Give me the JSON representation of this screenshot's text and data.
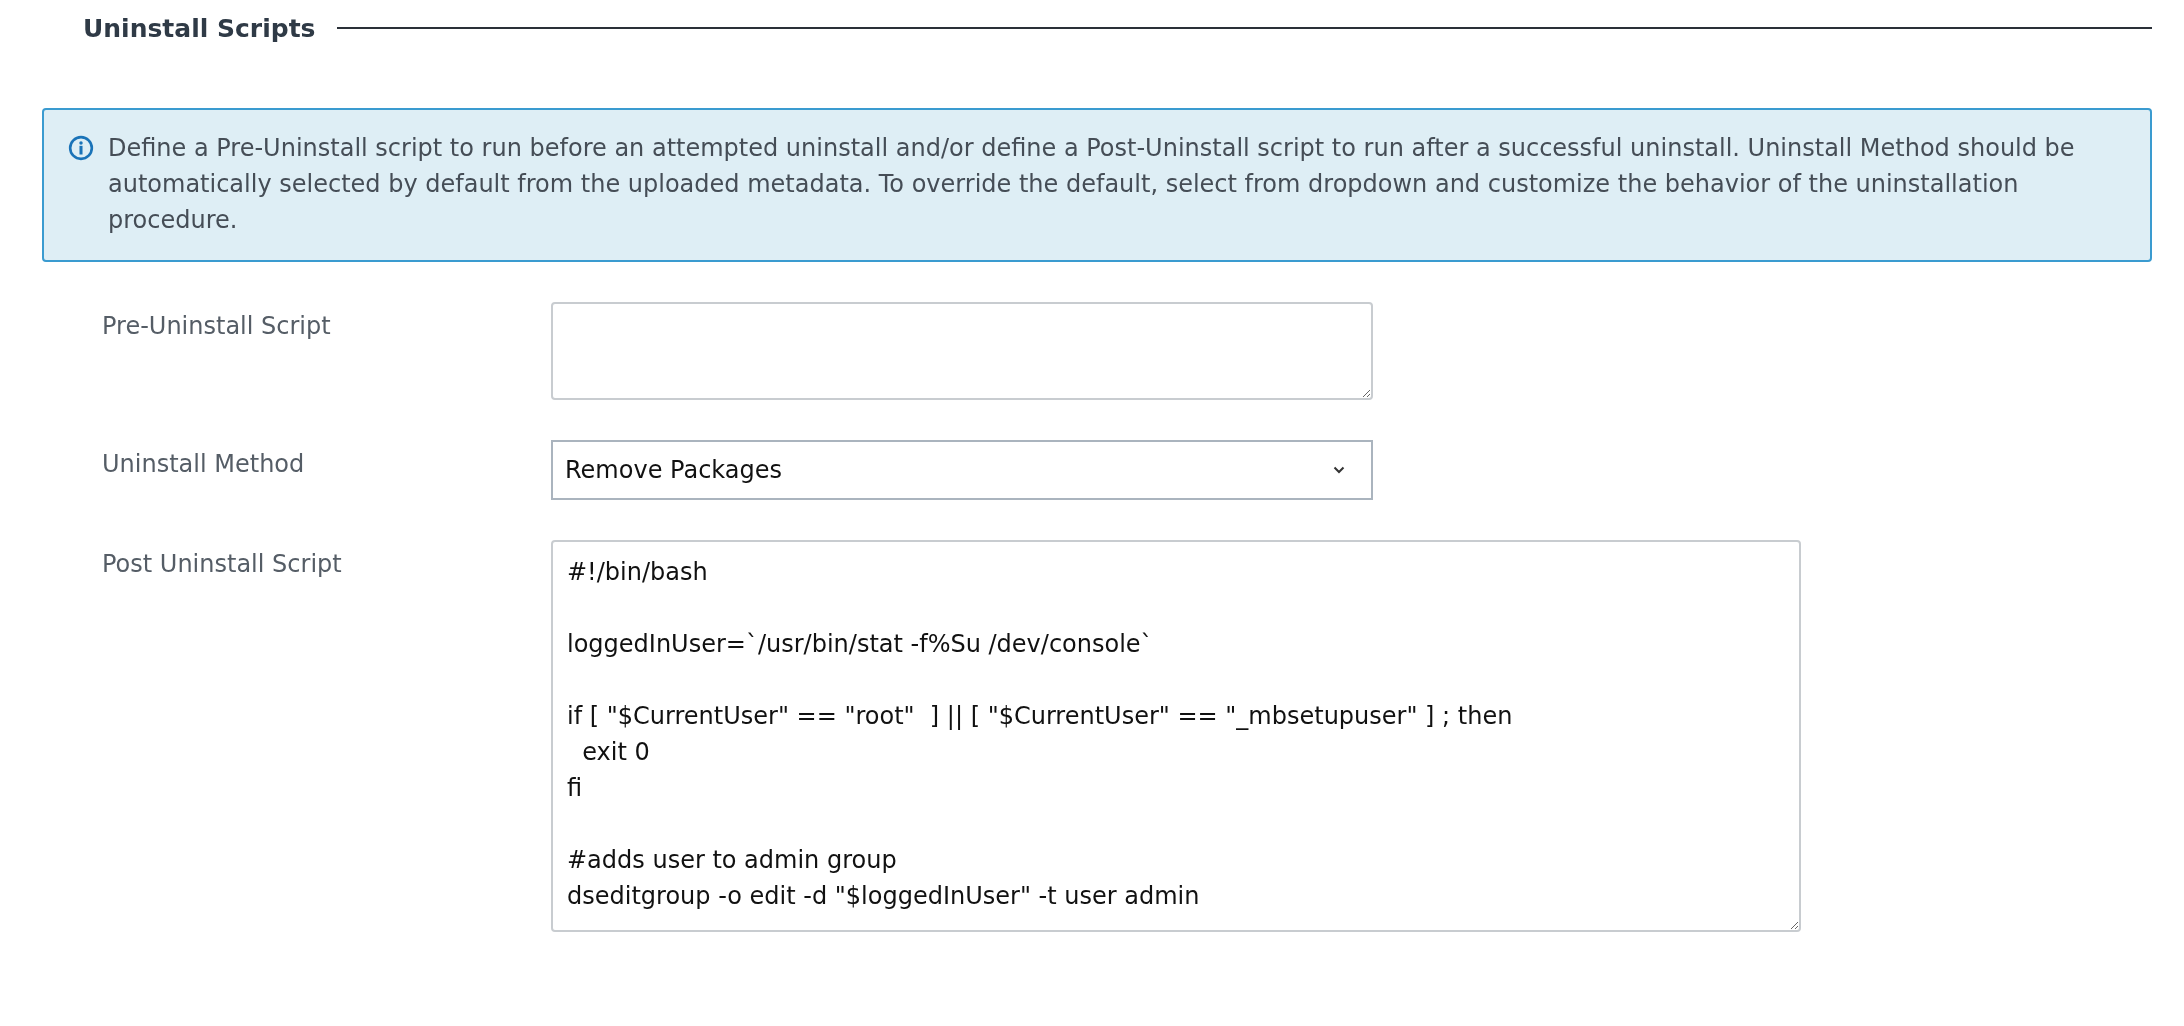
{
  "section": {
    "title": "Uninstall Scripts"
  },
  "info": {
    "text": "Define a Pre-Uninstall script to run before an attempted uninstall and/or define a Post-Uninstall script to run after a successful uninstall. Uninstall Method should be automatically selected by default from the uploaded metadata. To override the default, select from dropdown and customize the behavior of the uninstallation procedure."
  },
  "fields": [
    {
      "kind": "short-textarea",
      "label": "Pre-Uninstall Script"
    },
    {
      "kind": "select",
      "label": "Uninstall Method",
      "value": "Remove Packages"
    },
    {
      "kind": "tall-textarea",
      "label": "Post Uninstall Script",
      "value": "#!/bin/bash\n\nloggedInUser=`/usr/bin/stat -f%Su /dev/console`\n\nif [ \"$CurrentUser\" == \"root\"  ] || [ \"$CurrentUser\" == \"_mbsetupuser\" ] ; then\n  exit 0\nfi\n\n#adds user to admin group\ndseditgroup -o edit -d \"$loggedInUser\" -t user admin"
    }
  ]
}
